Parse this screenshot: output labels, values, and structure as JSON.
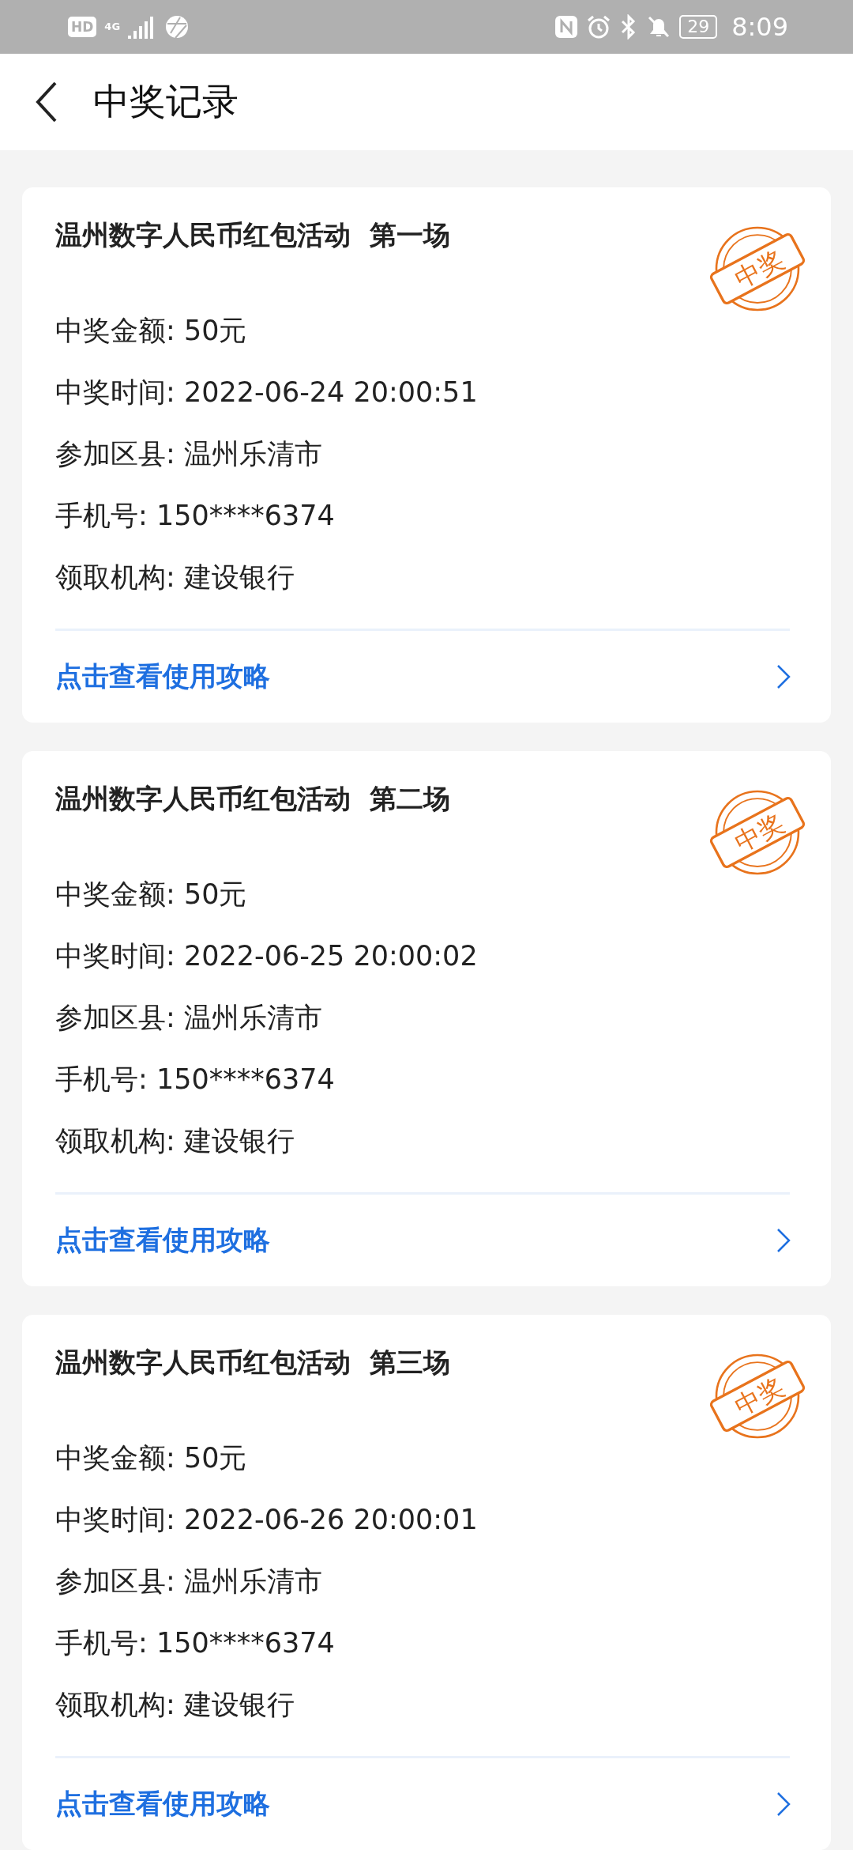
{
  "status_bar": {
    "hd": "HD",
    "network": "4G",
    "battery": "29",
    "time": "8:09"
  },
  "header": {
    "title": "中奖记录"
  },
  "records": [
    {
      "title": "温州数字人民币红包活动  第一场",
      "stamp": "中奖",
      "fields": [
        {
          "label": "中奖金额:",
          "value": "50元"
        },
        {
          "label": "中奖时间:",
          "value": "2022-06-24 20:00:51"
        },
        {
          "label": "参加区县:",
          "value": "温州乐清市"
        },
        {
          "label": "手机号:",
          "value": "150****6374"
        },
        {
          "label": "领取机构:",
          "value": "建设银行"
        }
      ],
      "link": "点击查看使用攻略"
    },
    {
      "title": "温州数字人民币红包活动  第二场",
      "stamp": "中奖",
      "fields": [
        {
          "label": "中奖金额:",
          "value": "50元"
        },
        {
          "label": "中奖时间:",
          "value": "2022-06-25 20:00:02"
        },
        {
          "label": "参加区县:",
          "value": "温州乐清市"
        },
        {
          "label": "手机号:",
          "value": "150****6374"
        },
        {
          "label": "领取机构:",
          "value": "建设银行"
        }
      ],
      "link": "点击查看使用攻略"
    },
    {
      "title": "温州数字人民币红包活动  第三场",
      "stamp": "中奖",
      "fields": [
        {
          "label": "中奖金额:",
          "value": "50元"
        },
        {
          "label": "中奖时间:",
          "value": "2022-06-26 20:00:01"
        },
        {
          "label": "参加区县:",
          "value": "温州乐清市"
        },
        {
          "label": "手机号:",
          "value": "150****6374"
        },
        {
          "label": "领取机构:",
          "value": "建设银行"
        }
      ],
      "link": "点击查看使用攻略"
    }
  ]
}
